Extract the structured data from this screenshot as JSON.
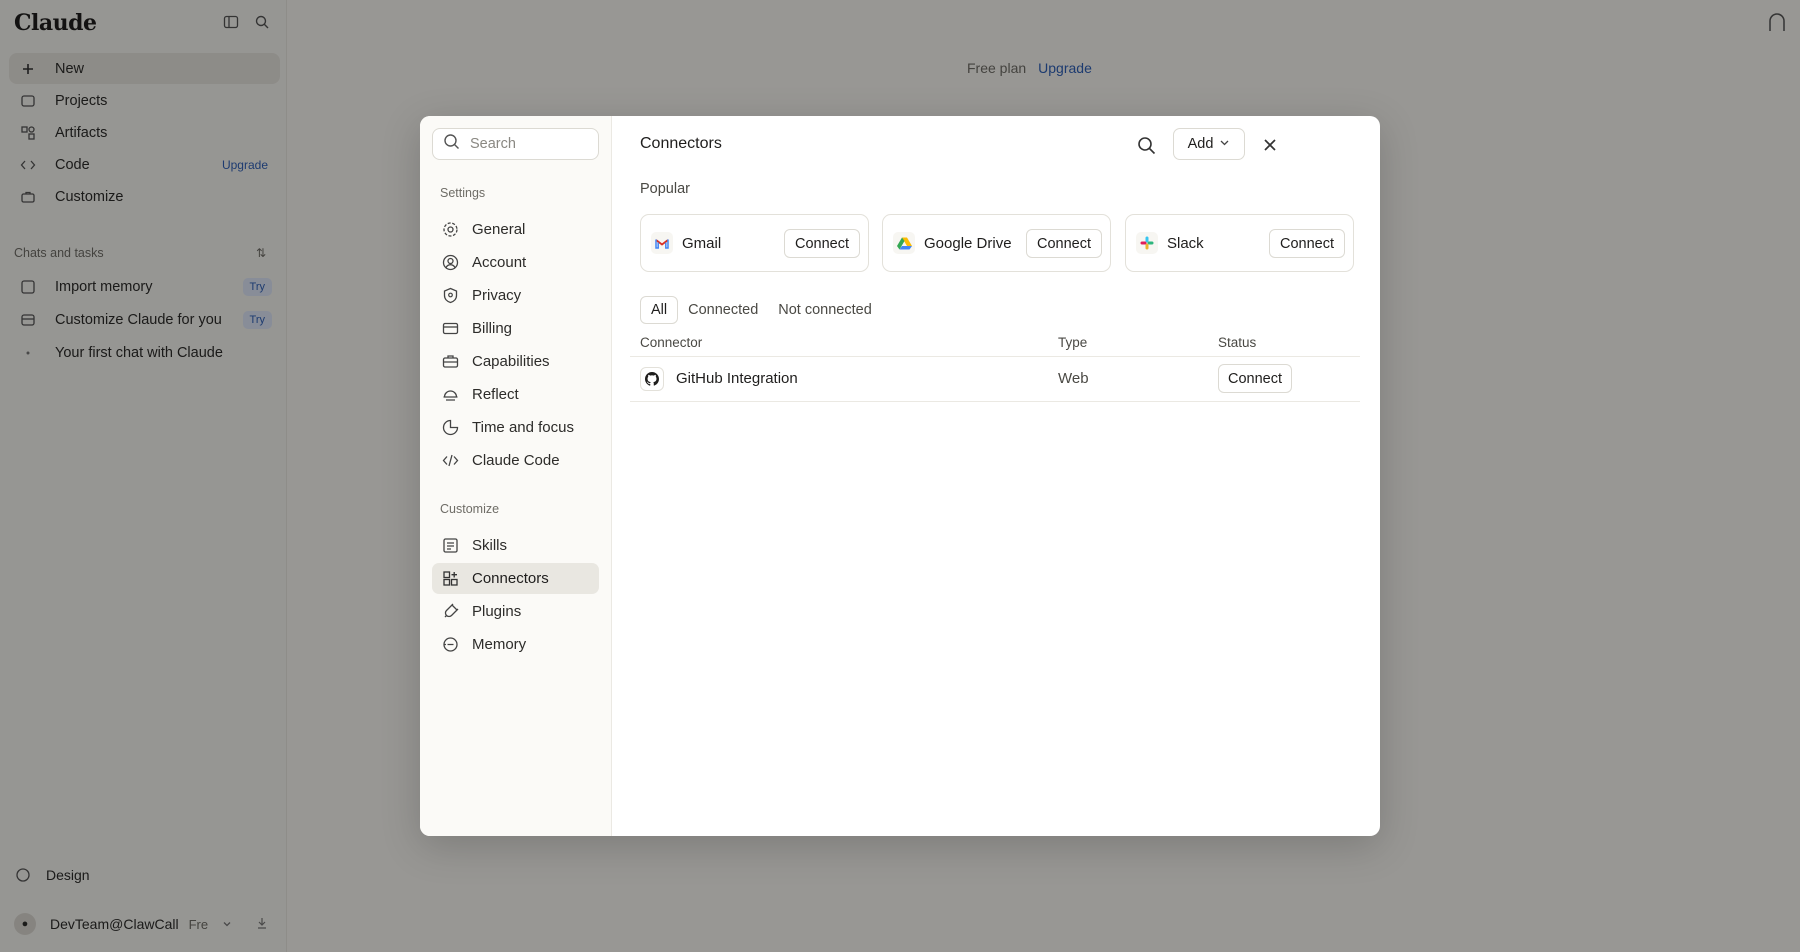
{
  "app": {
    "logo": "Claude",
    "nav": [
      {
        "label": "New",
        "icon": "plus-icon"
      },
      {
        "label": "Projects",
        "icon": "folder-icon"
      },
      {
        "label": "Artifacts",
        "icon": "artifacts-icon"
      },
      {
        "label": "Code",
        "icon": "code-icon",
        "badge": "Upgrade"
      },
      {
        "label": "Customize",
        "icon": "briefcase-icon"
      }
    ],
    "chats_label": "Chats and tasks",
    "chats_kbd": "⇅",
    "chats": [
      {
        "label": "Import memory",
        "badge": "Try"
      },
      {
        "label": "Customize Claude for you",
        "badge": "Try"
      },
      {
        "label": "Your first chat with Claude"
      }
    ],
    "design_label": "Design",
    "account_email": "DevTeam@ClawCall",
    "account_plan": "Fre",
    "plan_free": "Free plan",
    "plan_upgrade": "Upgrade"
  },
  "modal": {
    "search_placeholder": "Search",
    "settings_label": "Settings",
    "settings_items": [
      {
        "label": "General",
        "icon": "gear-icon"
      },
      {
        "label": "Account",
        "icon": "user-icon"
      },
      {
        "label": "Privacy",
        "icon": "shield-icon"
      },
      {
        "label": "Billing",
        "icon": "card-icon"
      },
      {
        "label": "Capabilities",
        "icon": "briefcase-icon"
      },
      {
        "label": "Reflect",
        "icon": "reflect-icon"
      },
      {
        "label": "Time and focus",
        "icon": "moon-icon"
      },
      {
        "label": "Claude Code",
        "icon": "code-icon"
      }
    ],
    "customize_label": "Customize",
    "customize_items": [
      {
        "label": "Skills",
        "icon": "skills-icon"
      },
      {
        "label": "Connectors",
        "icon": "connectors-icon",
        "active": true
      },
      {
        "label": "Plugins",
        "icon": "plug-icon"
      },
      {
        "label": "Memory",
        "icon": "memory-icon"
      }
    ],
    "title": "Connectors",
    "add_label": "Add",
    "popular_label": "Popular",
    "popular": [
      {
        "name": "Gmail",
        "icon": "gmail-icon",
        "action": "Connect"
      },
      {
        "name": "Google Drive",
        "icon": "google-drive-icon",
        "action": "Connect"
      },
      {
        "name": "Slack",
        "icon": "slack-icon",
        "action": "Connect"
      }
    ],
    "filters": [
      "All",
      "Connected",
      "Not connected"
    ],
    "active_filter": "All",
    "columns": [
      "Connector",
      "Type",
      "Status"
    ],
    "rows": [
      {
        "name": "GitHub Integration",
        "type": "Web",
        "action": "Connect",
        "icon": "github-icon"
      }
    ]
  },
  "colors": {
    "accent": "#2f5fb5",
    "overlay": "rgba(0,0,0,0.38)"
  }
}
